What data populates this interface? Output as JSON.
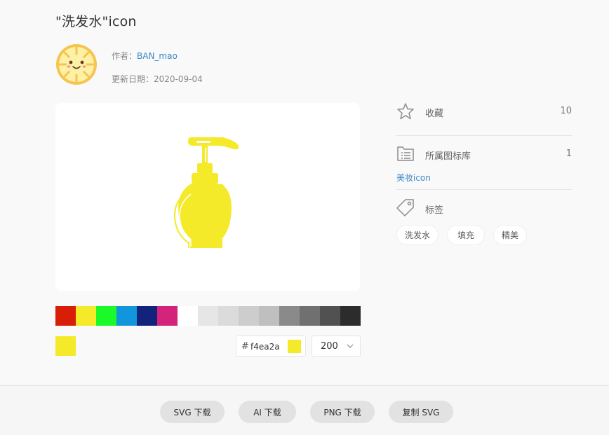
{
  "title": "\"洗发水\"icon",
  "author": {
    "label": "作者：",
    "name": "BAN_mao"
  },
  "update": {
    "label": "更新日期：",
    "date": "2020-09-04"
  },
  "palette": [
    "#d81e06",
    "#f4ea2a",
    "#1afa29",
    "#1296db",
    "#13227a",
    "#d4237a",
    "#ffffff",
    "#e6e6e6",
    "#dbdbdb",
    "#cdcdcd",
    "#bfbfbf",
    "#8a8a8a",
    "#707070",
    "#515151",
    "#2c2c2c"
  ],
  "current_color": "#f4ea2a",
  "color_input": {
    "hash": "#",
    "value": "f4ea2a"
  },
  "size": {
    "value": "200"
  },
  "sidebar": {
    "favorites": {
      "label": "收藏",
      "count": "10"
    },
    "library": {
      "label": "所属图标库",
      "count": "1",
      "link": "美妆icon"
    },
    "tags": {
      "label": "标签",
      "items": [
        "洗发水",
        "填充",
        "精美"
      ]
    }
  },
  "footer": {
    "buttons": [
      "SVG 下载",
      "AI 下载",
      "PNG 下载",
      "复制 SVG"
    ]
  },
  "icons": {
    "favorite": "star-icon",
    "library": "list-folder-icon",
    "tags": "tag-icon",
    "dropdown": "chevron-down-icon"
  }
}
